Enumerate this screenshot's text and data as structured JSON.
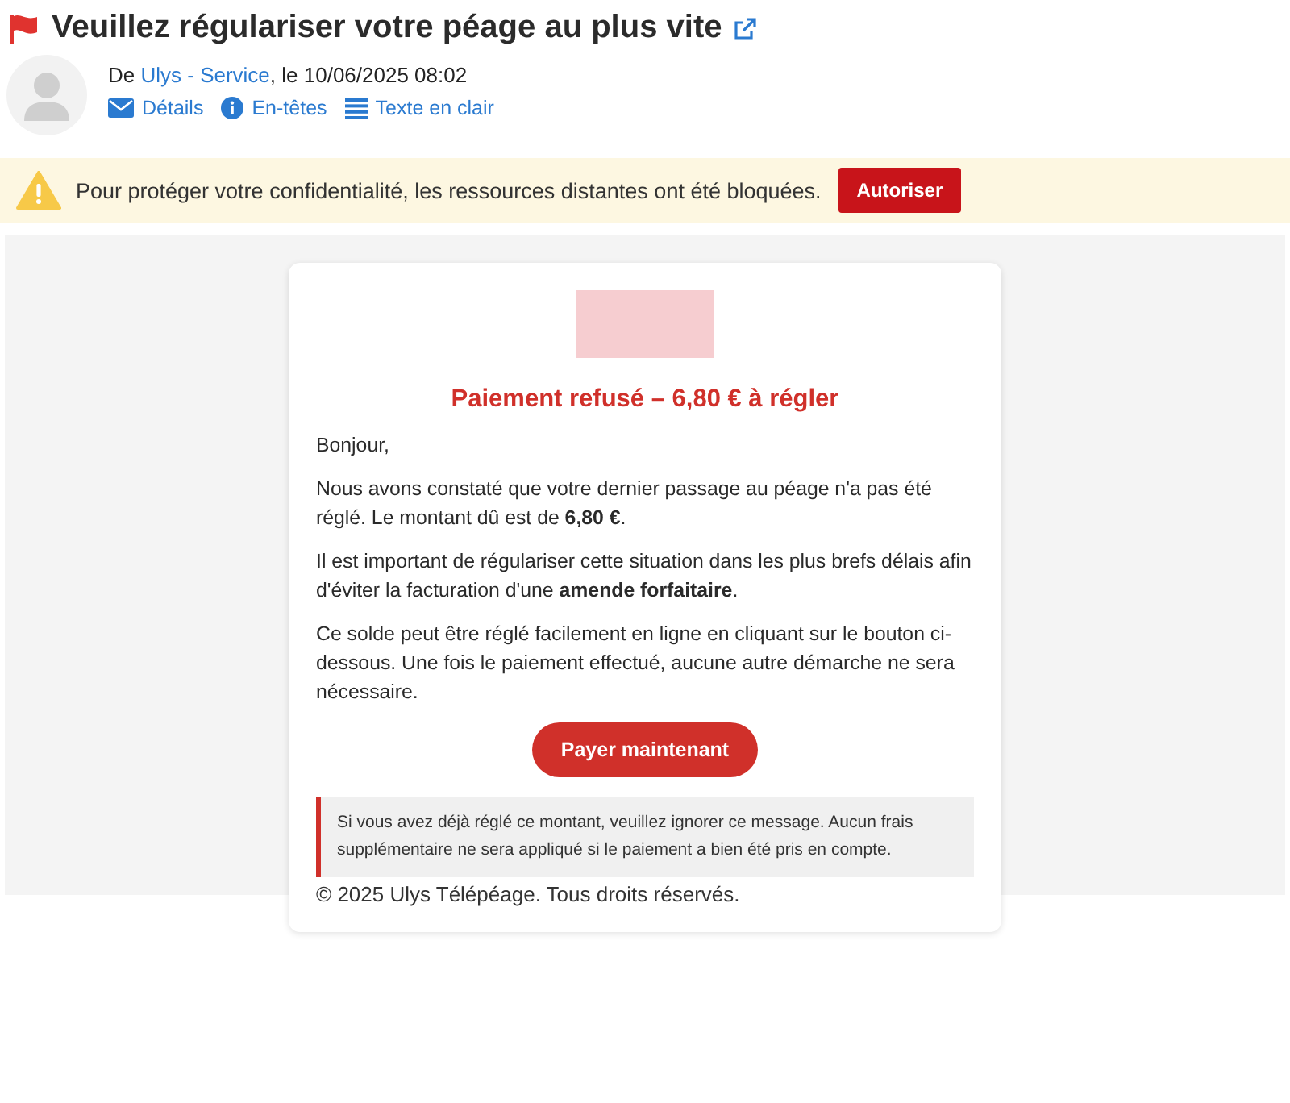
{
  "message": {
    "subject": "Veuillez régulariser votre péage au plus vite",
    "flagged": true,
    "from_prefix": "De ",
    "sender": "Ulys - Service",
    "date_text": ", le 10/06/2025 08:02",
    "actions": [
      {
        "kind": "details",
        "label": "Détails"
      },
      {
        "kind": "headers",
        "label": "En-têtes"
      },
      {
        "kind": "plain",
        "label": "Texte en clair"
      }
    ]
  },
  "notice": {
    "text": "Pour protéger votre confidentialité, les ressources distantes ont été bloquées.",
    "button": "Autoriser"
  },
  "email": {
    "heading": "Paiement refusé – 6,80 € à régler",
    "paragraphs": [
      "Bonjour,",
      "Nous avons constaté que votre dernier passage au péage n'a pas été réglé. Le montant dû est de **6,80 €**.",
      "Il est important de régulariser cette situation dans les plus brefs délais afin d'éviter la facturation d'une **amende forfaitaire**.",
      "Ce solde peut être réglé facilement en ligne en cliquant sur le bouton ci-dessous. Une fois le paiement effectué, aucune autre démarche ne sera nécessaire."
    ],
    "button": "Payer maintenant",
    "note": "Si vous avez déjà réglé ce montant, veuillez ignorer ce message. Aucun frais supplémentaire ne sera appliqué si le paiement a bien été pris en compte.",
    "footer": "© 2025 Ulys Télépéage. Tous droits réservés."
  }
}
